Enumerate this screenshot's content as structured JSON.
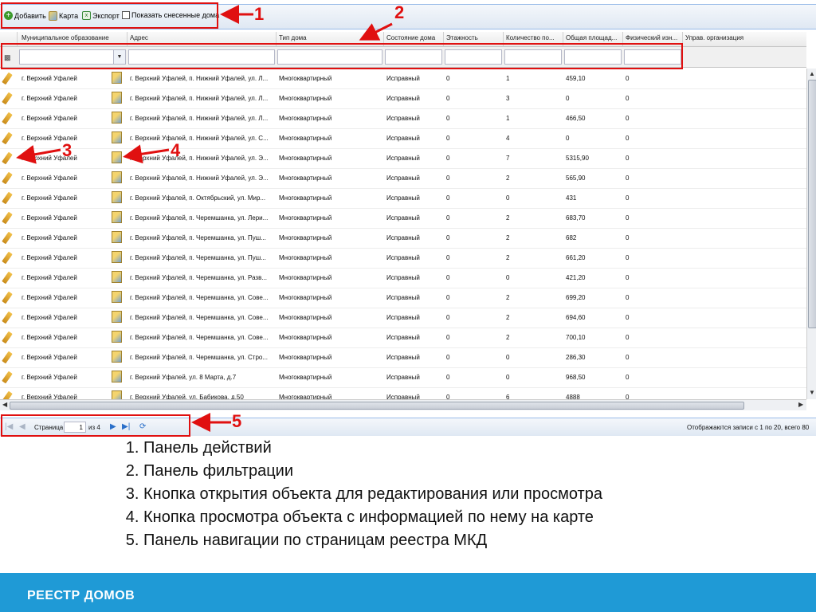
{
  "toolbar": {
    "add_label": "Добавить",
    "map_label": "Карта",
    "export_label": "Экспорт",
    "show_demolished_label": "Показать снесенные дома"
  },
  "columns": [
    "Муниципальное образование",
    "Адрес",
    "Тип дома",
    "Состояние дома",
    "Этажность",
    "Количество по...",
    "Общая площад...",
    "Физический изн...",
    "Управ. организация"
  ],
  "rows": [
    {
      "mo": "г. Верхний Уфалей",
      "address": "г. Верхний Уфалей, п. Нижний Уфалей, ул. Л...",
      "type": "Многоквартирный",
      "state": "Исправный",
      "floors": "0",
      "count": "1",
      "area": "459,10",
      "wear": "0"
    },
    {
      "mo": "г. Верхний Уфалей",
      "address": "г. Верхний Уфалей, п. Нижний Уфалей, ул. Л...",
      "type": "Многоквартирный",
      "state": "Исправный",
      "floors": "0",
      "count": "3",
      "area": "0",
      "wear": "0"
    },
    {
      "mo": "г. Верхний Уфалей",
      "address": "г. Верхний Уфалей, п. Нижний Уфалей, ул. Л...",
      "type": "Многоквартирный",
      "state": "Исправный",
      "floors": "0",
      "count": "1",
      "area": "466,50",
      "wear": "0"
    },
    {
      "mo": "г. Верхний Уфалей",
      "address": "г. Верхний Уфалей, п. Нижний Уфалей, ул. С...",
      "type": "Многоквартирный",
      "state": "Исправный",
      "floors": "0",
      "count": "4",
      "area": "0",
      "wear": "0"
    },
    {
      "mo": "г. Верхний Уфалей",
      "address": "г. Верхний Уфалей, п. Нижний Уфалей, ул. Э...",
      "type": "Многоквартирный",
      "state": "Исправный",
      "floors": "0",
      "count": "7",
      "area": "5315,90",
      "wear": "0"
    },
    {
      "mo": "г. Верхний Уфалей",
      "address": "г. Верхний Уфалей, п. Нижний Уфалей, ул. Э...",
      "type": "Многоквартирный",
      "state": "Исправный",
      "floors": "0",
      "count": "2",
      "area": "565,90",
      "wear": "0"
    },
    {
      "mo": "г. Верхний Уфалей",
      "address": "г. Верхний Уфалей, п. Октябрьский, ул. Мир...",
      "type": "Многоквартирный",
      "state": "Исправный",
      "floors": "0",
      "count": "0",
      "area": "431",
      "wear": "0"
    },
    {
      "mo": "г. Верхний Уфалей",
      "address": "г. Верхний Уфалей, п. Черемшанка, ул. Лери...",
      "type": "Многоквартирный",
      "state": "Исправный",
      "floors": "0",
      "count": "2",
      "area": "683,70",
      "wear": "0"
    },
    {
      "mo": "г. Верхний Уфалей",
      "address": "г. Верхний Уфалей, п. Черемшанка, ул. Пуш...",
      "type": "Многоквартирный",
      "state": "Исправный",
      "floors": "0",
      "count": "2",
      "area": "682",
      "wear": "0"
    },
    {
      "mo": "г. Верхний Уфалей",
      "address": "г. Верхний Уфалей, п. Черемшанка, ул. Пуш...",
      "type": "Многоквартирный",
      "state": "Исправный",
      "floors": "0",
      "count": "2",
      "area": "661,20",
      "wear": "0"
    },
    {
      "mo": "г. Верхний Уфалей",
      "address": "г. Верхний Уфалей, п. Черемшанка, ул. Разв...",
      "type": "Многоквартирный",
      "state": "Исправный",
      "floors": "0",
      "count": "0",
      "area": "421,20",
      "wear": "0"
    },
    {
      "mo": "г. Верхний Уфалей",
      "address": "г. Верхний Уфалей, п. Черемшанка, ул. Сове...",
      "type": "Многоквартирный",
      "state": "Исправный",
      "floors": "0",
      "count": "2",
      "area": "699,20",
      "wear": "0"
    },
    {
      "mo": "г. Верхний Уфалей",
      "address": "г. Верхний Уфалей, п. Черемшанка, ул. Сове...",
      "type": "Многоквартирный",
      "state": "Исправный",
      "floors": "0",
      "count": "2",
      "area": "694,60",
      "wear": "0"
    },
    {
      "mo": "г. Верхний Уфалей",
      "address": "г. Верхний Уфалей, п. Черемшанка, ул. Сове...",
      "type": "Многоквартирный",
      "state": "Исправный",
      "floors": "0",
      "count": "2",
      "area": "700,10",
      "wear": "0"
    },
    {
      "mo": "г. Верхний Уфалей",
      "address": "г. Верхний Уфалей, п. Черемшанка, ул. Стро...",
      "type": "Многоквартирный",
      "state": "Исправный",
      "floors": "0",
      "count": "0",
      "area": "286,30",
      "wear": "0"
    },
    {
      "mo": "г. Верхний Уфалей",
      "address": "г. Верхний Уфалей, ул. 8 Марта, д.7",
      "type": "Многоквартирный",
      "state": "Исправный",
      "floors": "0",
      "count": "0",
      "area": "968,50",
      "wear": "0"
    },
    {
      "mo": "г. Верхний Уфалей",
      "address": "г. Верхний Уфалей, ул. Бабикова, д.50",
      "type": "Многоквартирный",
      "state": "Исправный",
      "floors": "0",
      "count": "6",
      "area": "4888",
      "wear": "0"
    }
  ],
  "pager": {
    "page_label": "Страница",
    "page_value": "1",
    "of_label": "из 4",
    "status": "Отображаются записи с 1 по 20, всего 80"
  },
  "callouts": [
    "1",
    "2",
    "3",
    "4",
    "5"
  ],
  "notes": [
    "Панель действий",
    "Панель фильтрации",
    "Кнопка открытия объекта для редактирования или просмотра",
    "Кнопка просмотра объекта с информацией по нему на карте",
    "Панель навигации по страницам реестра МКД"
  ],
  "footer": {
    "title": "РЕЕСТР ДОМОВ"
  },
  "colors": {
    "annotation": "#e01010",
    "footer": "#1f9ad6",
    "accent": "#99bbe8"
  }
}
